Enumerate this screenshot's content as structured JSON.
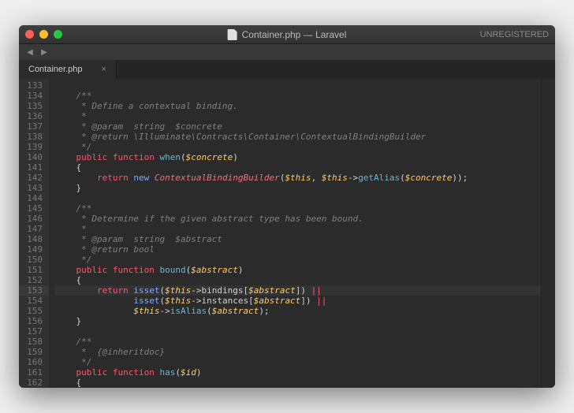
{
  "window": {
    "title": "Container.php — Laravel",
    "status": "UNREGISTERED"
  },
  "tabs": [
    {
      "label": "Container.php",
      "close": "×"
    }
  ],
  "gutter": {
    "start": 133,
    "end": 162
  },
  "highlighted_line": 153,
  "code_lines": [
    [
      [
        "p",
        ""
      ]
    ],
    [
      [
        "p",
        "    "
      ],
      [
        "c",
        "/**"
      ]
    ],
    [
      [
        "p",
        "    "
      ],
      [
        "c",
        " * Define a contextual binding."
      ]
    ],
    [
      [
        "p",
        "    "
      ],
      [
        "c",
        " *"
      ]
    ],
    [
      [
        "p",
        "    "
      ],
      [
        "c",
        " * @param  string  $concrete"
      ]
    ],
    [
      [
        "p",
        "    "
      ],
      [
        "c",
        " * @return \\Illuminate\\Contracts\\Container\\ContextualBindingBuilder"
      ]
    ],
    [
      [
        "p",
        "    "
      ],
      [
        "c",
        " */"
      ]
    ],
    [
      [
        "p",
        "    "
      ],
      [
        "k",
        "public"
      ],
      [
        "p",
        " "
      ],
      [
        "kf",
        "function"
      ],
      [
        "p",
        " "
      ],
      [
        "fn",
        "when"
      ],
      [
        "p",
        "("
      ],
      [
        "v",
        "$concrete"
      ],
      [
        "p",
        ")"
      ]
    ],
    [
      [
        "p",
        "    {"
      ]
    ],
    [
      [
        "p",
        "        "
      ],
      [
        "k",
        "return"
      ],
      [
        "p",
        " "
      ],
      [
        "kw2",
        "new"
      ],
      [
        "p",
        " "
      ],
      [
        "cls",
        "ContextualBindingBuilder"
      ],
      [
        "p",
        "("
      ],
      [
        "v",
        "$this"
      ],
      [
        "p",
        ", "
      ],
      [
        "v",
        "$this"
      ],
      [
        "p",
        "->"
      ],
      [
        "fn",
        "getAlias"
      ],
      [
        "p",
        "("
      ],
      [
        "v",
        "$concrete"
      ],
      [
        "p",
        "));"
      ]
    ],
    [
      [
        "p",
        "    }"
      ]
    ],
    [
      [
        "p",
        ""
      ]
    ],
    [
      [
        "p",
        "    "
      ],
      [
        "c",
        "/**"
      ]
    ],
    [
      [
        "p",
        "    "
      ],
      [
        "c",
        " * Determine if the given abstract type has been bound."
      ]
    ],
    [
      [
        "p",
        "    "
      ],
      [
        "c",
        " *"
      ]
    ],
    [
      [
        "p",
        "    "
      ],
      [
        "c",
        " * @param  string  $abstract"
      ]
    ],
    [
      [
        "p",
        "    "
      ],
      [
        "c",
        " * @return bool"
      ]
    ],
    [
      [
        "p",
        "    "
      ],
      [
        "c",
        " */"
      ]
    ],
    [
      [
        "p",
        "    "
      ],
      [
        "k",
        "public"
      ],
      [
        "p",
        " "
      ],
      [
        "kf",
        "function"
      ],
      [
        "p",
        " "
      ],
      [
        "fn",
        "bound"
      ],
      [
        "p",
        "("
      ],
      [
        "v",
        "$abstract"
      ],
      [
        "p",
        ")"
      ]
    ],
    [
      [
        "p",
        "    {"
      ]
    ],
    [
      [
        "p",
        "        "
      ],
      [
        "k",
        "return"
      ],
      [
        "p",
        " "
      ],
      [
        "kw2",
        "isset"
      ],
      [
        "p",
        "("
      ],
      [
        "v",
        "$this"
      ],
      [
        "p",
        "->bindings["
      ],
      [
        "v",
        "$abstract"
      ],
      [
        "p",
        "]) "
      ],
      [
        "op",
        "||"
      ]
    ],
    [
      [
        "p",
        "               "
      ],
      [
        "kw2",
        "isset"
      ],
      [
        "p",
        "("
      ],
      [
        "v",
        "$this"
      ],
      [
        "p",
        "->instances["
      ],
      [
        "v",
        "$abstract"
      ],
      [
        "p",
        "]) "
      ],
      [
        "op",
        "||"
      ]
    ],
    [
      [
        "p",
        "               "
      ],
      [
        "v",
        "$this"
      ],
      [
        "p",
        "->"
      ],
      [
        "fn",
        "isAlias"
      ],
      [
        "p",
        "("
      ],
      [
        "v",
        "$abstract"
      ],
      [
        "p",
        ");"
      ]
    ],
    [
      [
        "p",
        "    }"
      ]
    ],
    [
      [
        "p",
        ""
      ]
    ],
    [
      [
        "p",
        "    "
      ],
      [
        "c",
        "/**"
      ]
    ],
    [
      [
        "p",
        "    "
      ],
      [
        "c",
        " *  {@inheritdoc}"
      ]
    ],
    [
      [
        "p",
        "    "
      ],
      [
        "c",
        " */"
      ]
    ],
    [
      [
        "p",
        "    "
      ],
      [
        "k",
        "public"
      ],
      [
        "p",
        " "
      ],
      [
        "kf",
        "function"
      ],
      [
        "p",
        " "
      ],
      [
        "fn",
        "has"
      ],
      [
        "p",
        "("
      ],
      [
        "v",
        "$id"
      ],
      [
        "p",
        ")"
      ]
    ],
    [
      [
        "p",
        "    {"
      ]
    ]
  ],
  "icons": {
    "back": "◀",
    "forward": "▶"
  }
}
